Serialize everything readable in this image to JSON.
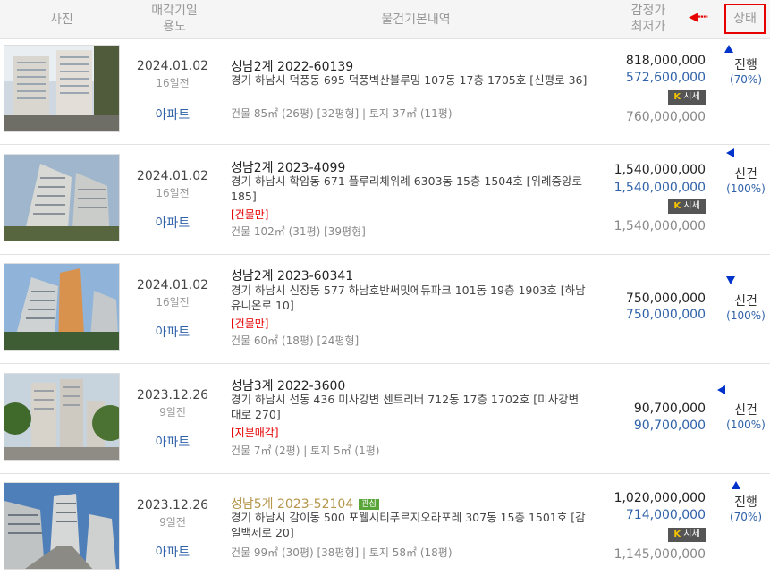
{
  "header": {
    "photo": "사진",
    "date_line1": "매각기일",
    "date_line2": "용도",
    "info": "물건기본내역",
    "price_line1": "감정가",
    "price_line2": "최저가",
    "arrow": "◀┅┅",
    "status": "상태"
  },
  "market_badge": {
    "kb": "K",
    "label": "시세"
  },
  "colors": {
    "accent_red": "#e60000",
    "link_blue": "#2f62a8",
    "gold_title": "#b5964b",
    "status_marker": "#0033cc"
  },
  "rows": [
    {
      "date": "2024.01.02",
      "days": "16일전",
      "usage": "아파트",
      "case": "성남2계 2022-60139",
      "address": "경기 하남시 덕풍동 695 덕풍벽산블루밍 107동 17층 1705호 [신평로 36]",
      "tag": "",
      "area": "건물 85㎡ (26평) [32평형]  |  토지 37㎡ (11평)",
      "appraisal": "818,000,000",
      "min_price": "572,600,000",
      "market": "760,000,000",
      "status": "진행",
      "pct": "(70%)"
    },
    {
      "date": "2024.01.02",
      "days": "16일전",
      "usage": "아파트",
      "case": "성남2계 2023-4099",
      "address": "경기 하남시 학암동 671 플루리체위례 6303동 15층 1504호 [위례중앙로 185]",
      "tag": "[건물만]",
      "area": "건물 102㎡ (31평) [39평형]",
      "appraisal": "1,540,000,000",
      "min_price": "1,540,000,000",
      "market": "1,540,000,000",
      "status": "신건",
      "pct": "(100%)"
    },
    {
      "date": "2024.01.02",
      "days": "16일전",
      "usage": "아파트",
      "case": "성남2계 2023-60341",
      "address": "경기 하남시 신장동 577 하남호반써밋에듀파크 101동 19층 1903호 [하남유니온로 10]",
      "tag": "[건물만]",
      "area": "건물 60㎡ (18평) [24평형]",
      "appraisal": "750,000,000",
      "min_price": "750,000,000",
      "market": "",
      "status": "신건",
      "pct": "(100%)"
    },
    {
      "date": "2023.12.26",
      "days": "9일전",
      "usage": "아파트",
      "case": "성남3계 2022-3600",
      "address": "경기 하남시 선동 436 미사강변 센트리버 712동 17층 1702호 [미사강변대로 270]",
      "tag": "[지분매각]",
      "area": "건물 7㎡ (2평)  |  토지 5㎡ (1평)",
      "appraisal": "90,700,000",
      "min_price": "90,700,000",
      "market": "",
      "status": "신건",
      "pct": "(100%)"
    },
    {
      "date": "2023.12.26",
      "days": "9일전",
      "usage": "아파트",
      "case": "성남5계 2023-52104",
      "badge": "관심",
      "address": "경기 하남시 감이동 500 포웰시티푸르지오라포레 307동 15층 1501호 [감일백제로 20]",
      "tag": "",
      "area": "건물 99㎡ (30평) [38평형]  |  토지 58㎡ (18평)",
      "appraisal": "1,020,000,000",
      "min_price": "714,000,000",
      "market": "1,145,000,000",
      "status": "진행",
      "pct": "(70%)"
    }
  ]
}
